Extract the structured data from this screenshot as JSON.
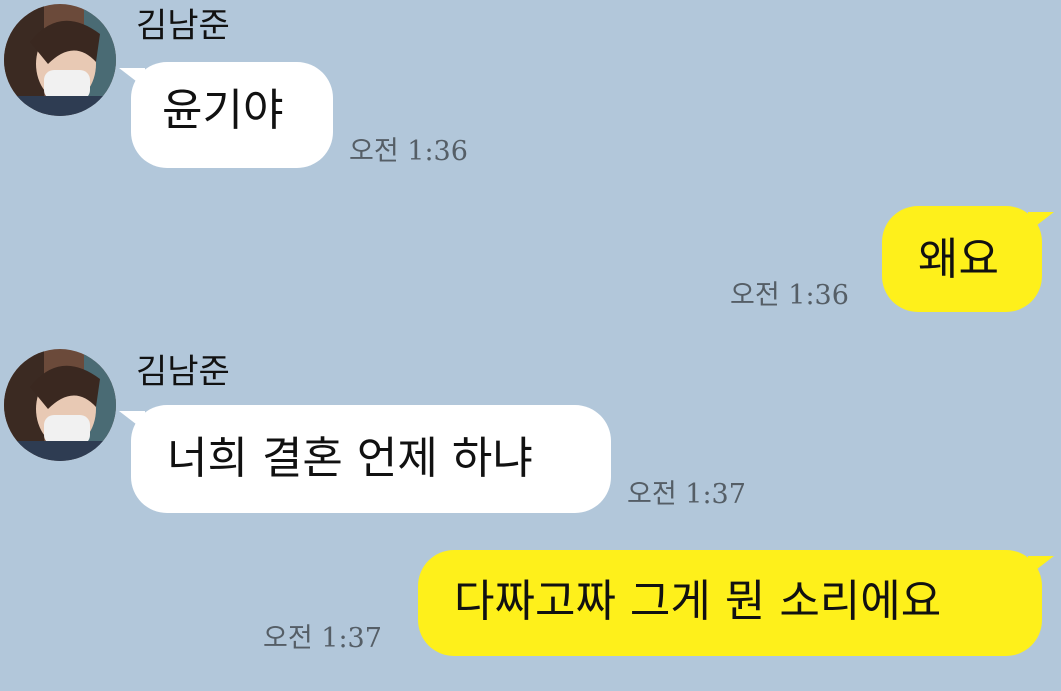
{
  "chat": {
    "messages": [
      {
        "sender": "김남준",
        "text": "윤기야",
        "time": "오전 1:36",
        "direction": "incoming"
      },
      {
        "text": "왜요",
        "time": "오전 1:36",
        "direction": "outgoing"
      },
      {
        "sender": "김남준",
        "text": "너희 결혼 언제 하냐",
        "time": "오전 1:37",
        "direction": "incoming"
      },
      {
        "text": "다짜고짜 그게 뭔 소리에요",
        "time": "오전 1:37",
        "direction": "outgoing"
      }
    ]
  },
  "colors": {
    "background": "#b2c7da",
    "incoming_bubble": "#ffffff",
    "outgoing_bubble": "#fef01b",
    "timestamp": "#555e66"
  }
}
